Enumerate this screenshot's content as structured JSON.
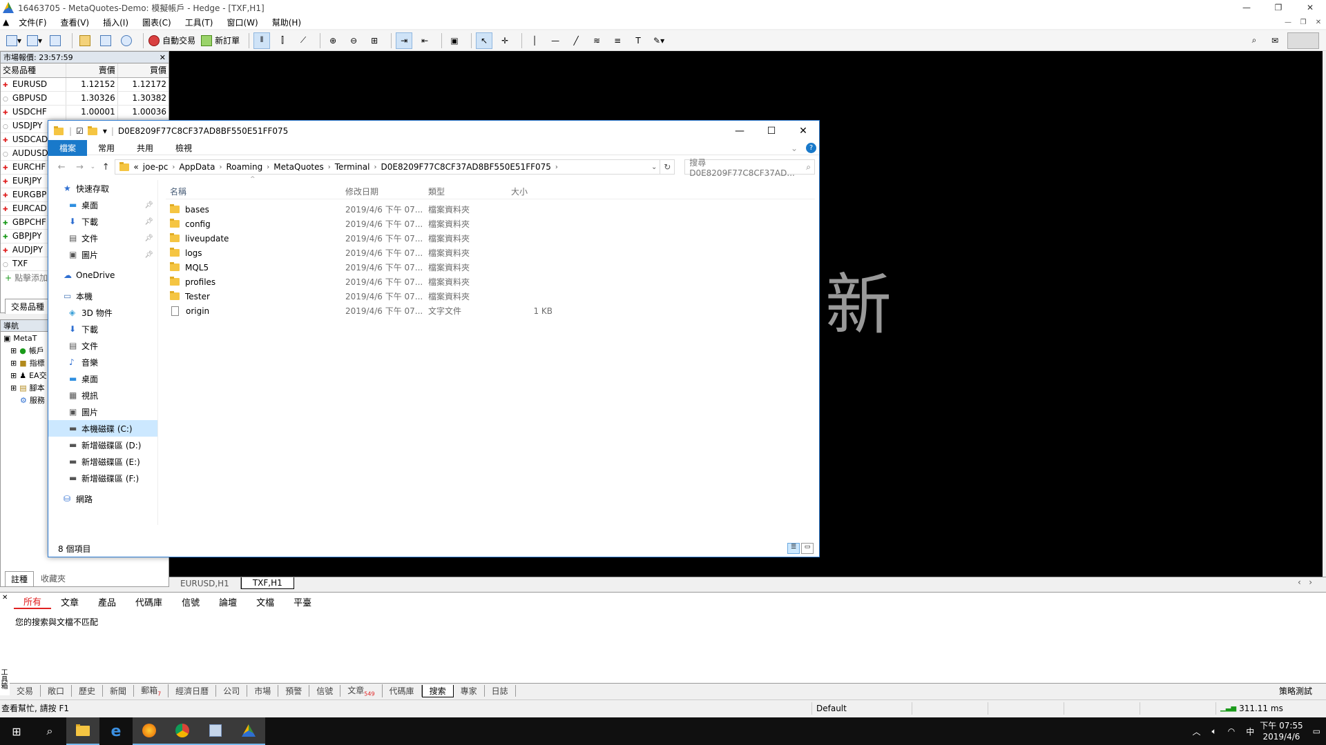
{
  "window": {
    "title": "16463705 - MetaQuotes-Demo: 模擬帳戶 - Hedge - [TXF,H1]",
    "controls": [
      "—",
      "❐",
      "✕"
    ]
  },
  "menu": [
    "文件(F)",
    "查看(V)",
    "插入(I)",
    "圖表(C)",
    "工具(T)",
    "窗口(W)",
    "幫助(H)"
  ],
  "toolbar": {
    "auto_trade": "自動交易",
    "new_order": "新訂單"
  },
  "market_watch": {
    "header": "市場報價: 23:57:59",
    "col_symbol": "交易品種",
    "col_bid": "賣價",
    "col_ask": "買價",
    "rows": [
      {
        "dir": "down",
        "symbol": "EURUSD",
        "bid": "1.12152",
        "ask": "1.12172"
      },
      {
        "dir": "flat",
        "symbol": "GBPUSD",
        "bid": "1.30326",
        "ask": "1.30382"
      },
      {
        "dir": "down",
        "symbol": "USDCHF",
        "bid": "1.00001",
        "ask": "1.00036"
      },
      {
        "dir": "flat",
        "symbol": "USDJPY",
        "bid": "",
        "ask": ""
      },
      {
        "dir": "down",
        "symbol": "USDCAD",
        "bid": "",
        "ask": ""
      },
      {
        "dir": "flat",
        "symbol": "AUDUSD",
        "bid": "",
        "ask": ""
      },
      {
        "dir": "down",
        "symbol": "EURCHF",
        "bid": "",
        "ask": ""
      },
      {
        "dir": "down",
        "symbol": "EURJPY",
        "bid": "",
        "ask": ""
      },
      {
        "dir": "down",
        "symbol": "EURGBP",
        "bid": "",
        "ask": ""
      },
      {
        "dir": "down",
        "symbol": "EURCAD",
        "bid": "",
        "ask": ""
      },
      {
        "dir": "up",
        "symbol": "GBPCHF",
        "bid": "",
        "ask": ""
      },
      {
        "dir": "up",
        "symbol": "GBPJPY",
        "bid": "",
        "ask": ""
      },
      {
        "dir": "down",
        "symbol": "AUDJPY",
        "bid": "",
        "ask": ""
      },
      {
        "dir": "flat",
        "symbol": "TXF",
        "bid": "",
        "ask": ""
      }
    ],
    "add_label": "點擊添加",
    "tab": "交易品種"
  },
  "navigator": {
    "header": "導航",
    "items": [
      "MetaT",
      "帳戶",
      "指標",
      "EA交",
      "腳本",
      "服務"
    ],
    "tabs": [
      "註種",
      "收藏夾"
    ]
  },
  "chart": {
    "overlay_glyph": "新",
    "tabs": [
      "EURUSD,H1",
      "TXF,H1"
    ],
    "active_tab": 1
  },
  "explorer": {
    "title": "D0E8209F77C8CF37AD8BF550E51FF075",
    "ribbon": [
      "檔案",
      "常用",
      "共用",
      "檢視"
    ],
    "breadcrumb": [
      "«",
      "joe-pc",
      "AppData",
      "Roaming",
      "MetaQuotes",
      "Terminal",
      "D0E8209F77C8CF37AD8BF550E51FF075"
    ],
    "search_placeholder": "搜尋 D0E8209F77C8CF37AD...",
    "sidebar": [
      {
        "label": "快速存取",
        "icon": "star-icon",
        "level": 0,
        "pin": false
      },
      {
        "label": "桌面",
        "icon": "desktop-icon",
        "level": 1,
        "pin": true
      },
      {
        "label": "下載",
        "icon": "download-icon",
        "level": 1,
        "pin": true
      },
      {
        "label": "文件",
        "icon": "document-icon",
        "level": 1,
        "pin": true
      },
      {
        "label": "圖片",
        "icon": "picture-icon",
        "level": 1,
        "pin": true
      },
      {
        "label": "OneDrive",
        "icon": "cloud-icon",
        "level": 0,
        "pin": false
      },
      {
        "label": "本機",
        "icon": "computer-icon",
        "level": 0,
        "pin": false
      },
      {
        "label": "3D 物件",
        "icon": "cube-icon",
        "level": 1,
        "pin": false
      },
      {
        "label": "下載",
        "icon": "download-icon",
        "level": 1,
        "pin": false
      },
      {
        "label": "文件",
        "icon": "document-icon",
        "level": 1,
        "pin": false
      },
      {
        "label": "音樂",
        "icon": "music-icon",
        "level": 1,
        "pin": false
      },
      {
        "label": "桌面",
        "icon": "desktop-icon",
        "level": 1,
        "pin": false
      },
      {
        "label": "視訊",
        "icon": "video-icon",
        "level": 1,
        "pin": false
      },
      {
        "label": "圖片",
        "icon": "picture-icon",
        "level": 1,
        "pin": false
      },
      {
        "label": "本機磁碟 (C:)",
        "icon": "drive-icon",
        "level": 1,
        "pin": false
      },
      {
        "label": "新增磁碟區 (D:)",
        "icon": "drive-icon",
        "level": 1,
        "pin": false
      },
      {
        "label": "新增磁碟區 (E:)",
        "icon": "drive-icon",
        "level": 1,
        "pin": false
      },
      {
        "label": "新增磁碟區 (F:)",
        "icon": "drive-icon",
        "level": 1,
        "pin": false
      },
      {
        "label": "網路",
        "icon": "network-icon",
        "level": 0,
        "pin": false
      }
    ],
    "columns": [
      "名稱",
      "修改日期",
      "類型",
      "大小"
    ],
    "files": [
      {
        "name": "bases",
        "date": "2019/4/6 下午 07...",
        "type": "檔案資料夾",
        "size": "",
        "kind": "folder"
      },
      {
        "name": "config",
        "date": "2019/4/6 下午 07...",
        "type": "檔案資料夾",
        "size": "",
        "kind": "folder"
      },
      {
        "name": "liveupdate",
        "date": "2019/4/6 下午 07...",
        "type": "檔案資料夾",
        "size": "",
        "kind": "folder"
      },
      {
        "name": "logs",
        "date": "2019/4/6 下午 07...",
        "type": "檔案資料夾",
        "size": "",
        "kind": "folder"
      },
      {
        "name": "MQL5",
        "date": "2019/4/6 下午 07...",
        "type": "檔案資料夾",
        "size": "",
        "kind": "folder"
      },
      {
        "name": "profiles",
        "date": "2019/4/6 下午 07...",
        "type": "檔案資料夾",
        "size": "",
        "kind": "folder"
      },
      {
        "name": "Tester",
        "date": "2019/4/6 下午 07...",
        "type": "檔案資料夾",
        "size": "",
        "kind": "folder"
      },
      {
        "name": "origin",
        "date": "2019/4/6 下午 07...",
        "type": "文字文件",
        "size": "1 KB",
        "kind": "file"
      }
    ],
    "status": "8 個項目"
  },
  "toolbox": {
    "search_tabs": [
      "所有",
      "文章",
      "產品",
      "代碼庫",
      "信號",
      "論壇",
      "文檔",
      "平臺"
    ],
    "message": "您的搜索與文檔不匹配",
    "vertical_label": "工具箱",
    "tabs": [
      "交易",
      "敞口",
      "歷史",
      "新聞",
      "郵箱",
      "經濟日曆",
      "公司",
      "市場",
      "預警",
      "信號",
      "文章",
      "代碼庫",
      "搜索",
      "專家",
      "日誌"
    ],
    "badges": {
      "郵箱": "7",
      "文章": "549"
    },
    "active_tab": "搜索",
    "tester_label": "策略測試"
  },
  "statusbar": {
    "help": "查看幫忙, 請按 F1",
    "profile": "Default",
    "ping": "311.11 ms"
  },
  "taskbar": {
    "time": "下午 07:55",
    "date": "2019/4/6",
    "ime": "中"
  }
}
